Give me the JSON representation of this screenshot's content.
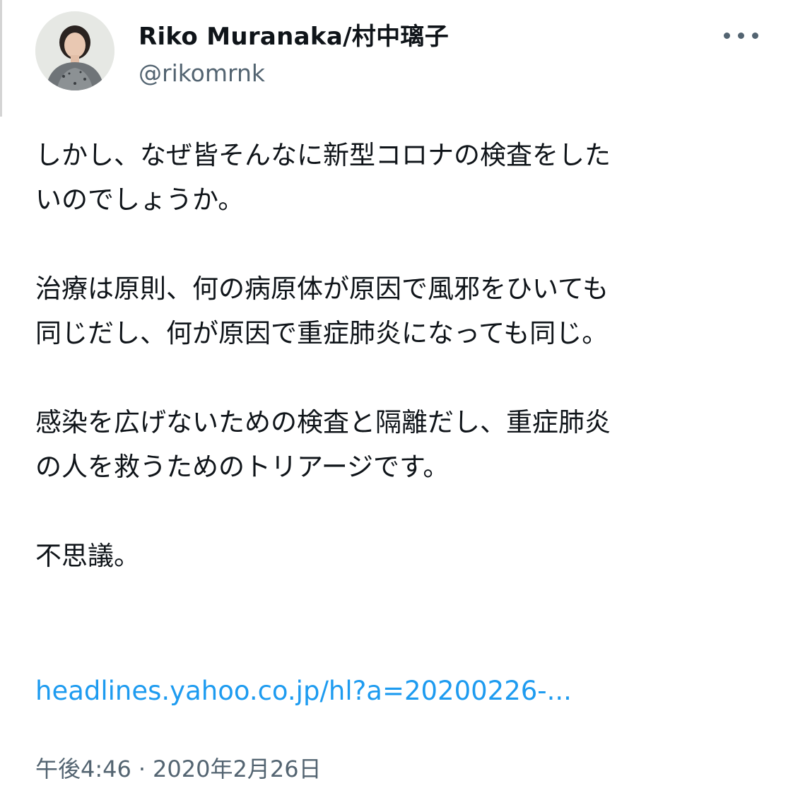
{
  "author": {
    "display_name": "Riko Muranaka/村中璃子",
    "handle": "@rikomrnk"
  },
  "more_icon": "more-horizontal-icon",
  "tweet": {
    "paragraphs": [
      [
        "しかし、なぜ皆そんなに新型コロナの検査をした",
        "いのでしょうか。"
      ],
      [
        "治療は原則、何の病原体が原因で風邪をひいても",
        "同じだし、何が原因で重症肺炎になっても同じ。"
      ],
      [
        "感染を広げないための検査と隔離だし、重症肺炎",
        "の人を救うためのトリアージです。"
      ],
      [
        "不思議。"
      ]
    ],
    "link_text": "headlines.yahoo.co.jp/hl?a=20200226-..."
  },
  "meta": {
    "time": "午後4:46",
    "separator": "·",
    "date": "2020年2月26日"
  },
  "colors": {
    "text": "#0f1419",
    "secondary": "#536471",
    "link": "#1d9bf0"
  }
}
